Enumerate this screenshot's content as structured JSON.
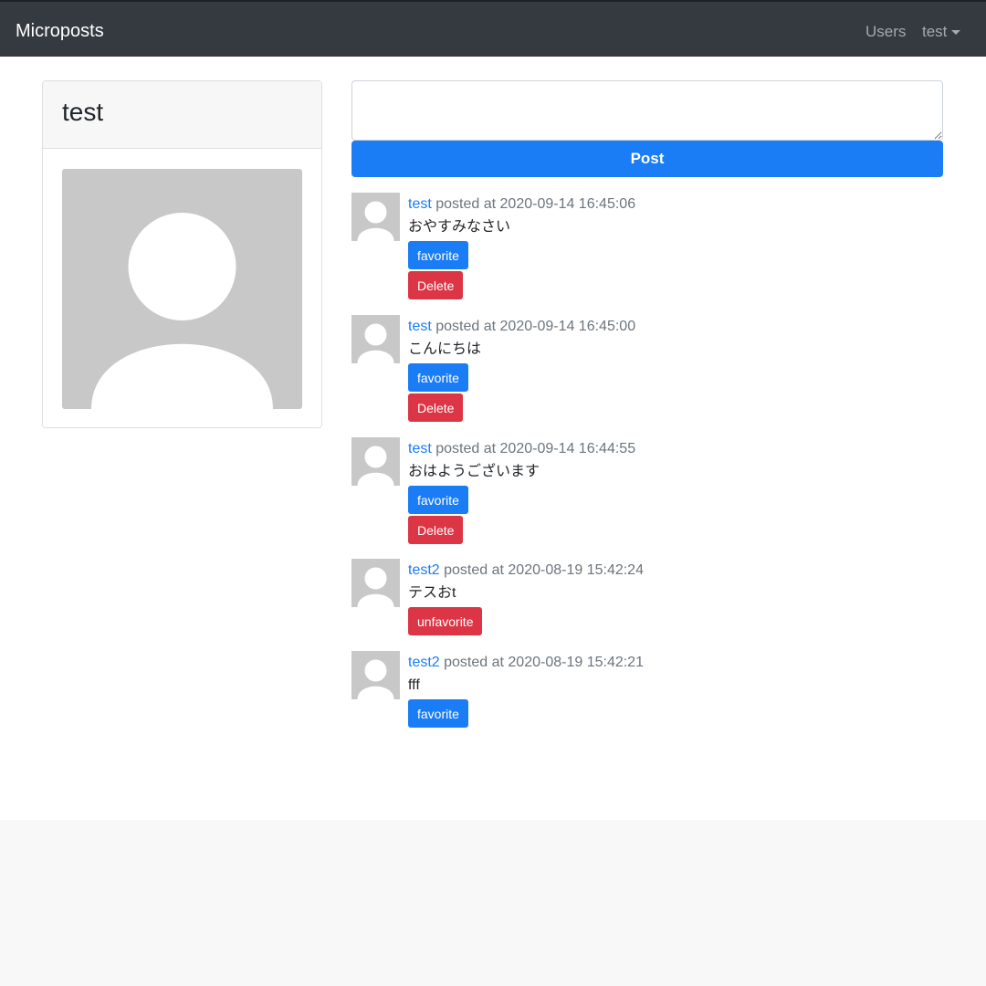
{
  "navbar": {
    "brand": "Microposts",
    "users_link": "Users",
    "user_menu": "test"
  },
  "profile": {
    "name": "test"
  },
  "composer": {
    "post_label": "Post"
  },
  "posts": [
    {
      "user": "test",
      "posted_at": " posted at 2020-09-14 16:45:06",
      "content": "おやすみなさい",
      "action": "favorite",
      "delete": "Delete"
    },
    {
      "user": "test",
      "posted_at": " posted at 2020-09-14 16:45:00",
      "content": "こんにちは",
      "action": "favorite",
      "delete": "Delete"
    },
    {
      "user": "test",
      "posted_at": " posted at 2020-09-14 16:44:55",
      "content": "おはようございます",
      "action": "favorite",
      "delete": "Delete"
    },
    {
      "user": "test2",
      "posted_at": " posted at 2020-08-19 15:42:24",
      "content": "テスおt",
      "action": "unfavorite"
    },
    {
      "user": "test2",
      "posted_at": " posted at 2020-08-19 15:42:21",
      "content": "fff",
      "action": "favorite"
    }
  ]
}
